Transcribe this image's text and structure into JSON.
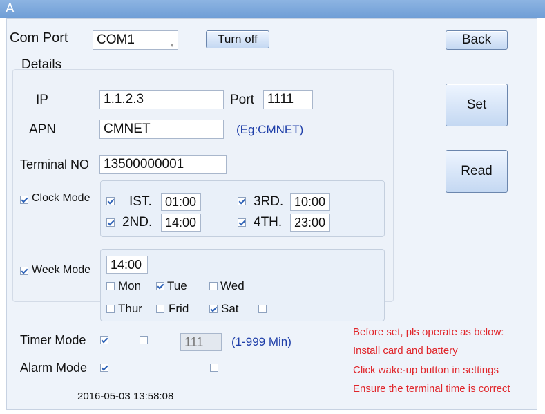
{
  "window": {
    "title": "A"
  },
  "com_port": {
    "label": "Com Port",
    "value": "COM1",
    "turn_off_label": "Turn off"
  },
  "buttons": {
    "back": "Back",
    "set": "Set",
    "read": "Read"
  },
  "details": {
    "heading": "Details",
    "ip_label": "IP",
    "ip_value": "1.1.2.3",
    "port_label": "Port",
    "port_value": "1111",
    "apn_label": "APN",
    "apn_value": "CMNET",
    "apn_hint": "(Eg:CMNET)",
    "terminal_label": "Terminal NO",
    "terminal_value": "13500000001"
  },
  "clock_mode": {
    "label": "Clock Mode",
    "checked": true,
    "slots": [
      {
        "label": "IST.",
        "value": "01:00",
        "checked": true
      },
      {
        "label": "3RD.",
        "value": "10:00",
        "checked": true
      },
      {
        "label": "2ND.",
        "value": "14:00",
        "checked": true
      },
      {
        "label": "4TH.",
        "value": "23:00",
        "checked": true
      }
    ]
  },
  "week_mode": {
    "label": "Week Mode",
    "checked": true,
    "time": "14:00",
    "days": [
      {
        "label": "Mon",
        "checked": false
      },
      {
        "label": "Tue",
        "checked": true
      },
      {
        "label": "Wed",
        "checked": false
      },
      {
        "label": "Thur",
        "checked": false
      },
      {
        "label": "Frid",
        "checked": false
      },
      {
        "label": "Sat",
        "checked": true
      },
      {
        "label": "",
        "checked": false
      }
    ]
  },
  "timer_mode": {
    "label": "Timer Mode",
    "checked": true,
    "sub_checked": false,
    "value": "111",
    "range_hint": "(1-999 Min)"
  },
  "alarm_mode": {
    "label": "Alarm Mode",
    "checked": true,
    "sub_checked": false
  },
  "timestamp": "2016-05-03  13:58:08",
  "notes": [
    "Before set, pls operate as below:",
    "Install card and battery",
    "Click wake-up button in settings",
    "Ensure the terminal time is correct"
  ],
  "colors": {
    "titlebar": "#7aa7dd",
    "hint_blue": "#1f3fa9",
    "note_red": "#e0262b"
  }
}
